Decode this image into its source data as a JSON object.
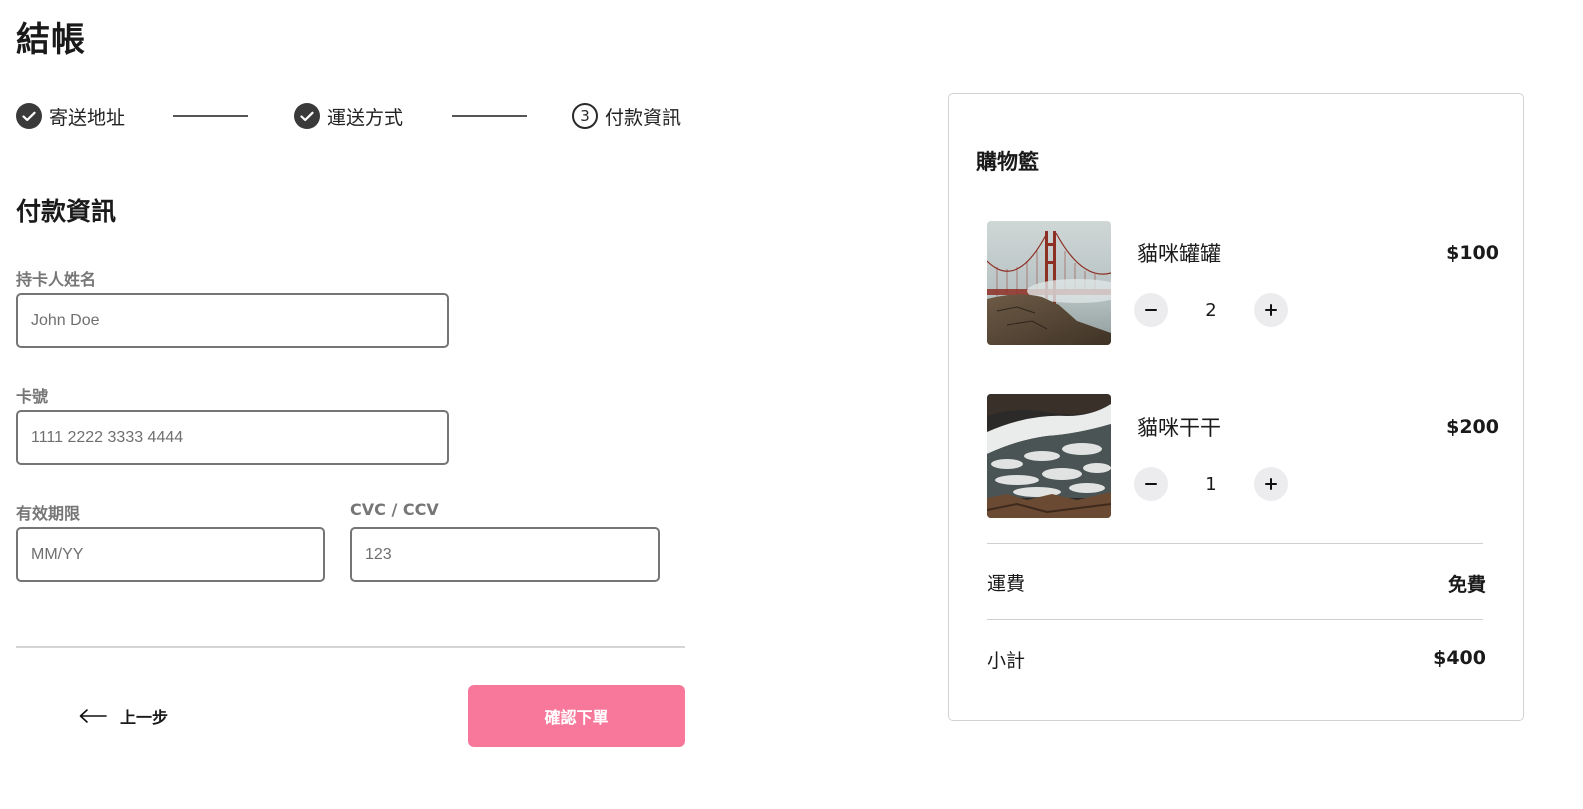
{
  "page": {
    "title": "結帳"
  },
  "stepper": {
    "steps": [
      {
        "label": "寄送地址",
        "state": "done"
      },
      {
        "label": "運送方式",
        "state": "done"
      },
      {
        "label": "付款資訊",
        "state": "current",
        "number": "3"
      }
    ]
  },
  "payment": {
    "title": "付款資訊",
    "cardholder": {
      "label": "持卡人姓名",
      "placeholder": "John Doe"
    },
    "card_number": {
      "label": "卡號",
      "placeholder": "1111 2222 3333 4444"
    },
    "expiry": {
      "label": "有效期限",
      "placeholder": "MM/YY"
    },
    "cvc": {
      "label": "CVC / CCV",
      "placeholder": "123"
    }
  },
  "actions": {
    "back_label": "上一步",
    "confirm_label": "確認下單"
  },
  "cart": {
    "title": "購物籃",
    "items": [
      {
        "name": "貓咪罐罐",
        "price": "$100",
        "quantity": "2",
        "image": "golden-gate-bridge-fog-photo"
      },
      {
        "name": "貓咪干干",
        "price": "$200",
        "quantity": "1",
        "image": "ocean-waves-aerial-photo"
      }
    ],
    "shipping": {
      "label": "運費",
      "value": "免費"
    },
    "subtotal": {
      "label": "小計",
      "value": "$400"
    }
  },
  "colors": {
    "accent": "#f7789a",
    "step_done": "#3a3a3a",
    "qty_button_bg": "#ececef"
  }
}
